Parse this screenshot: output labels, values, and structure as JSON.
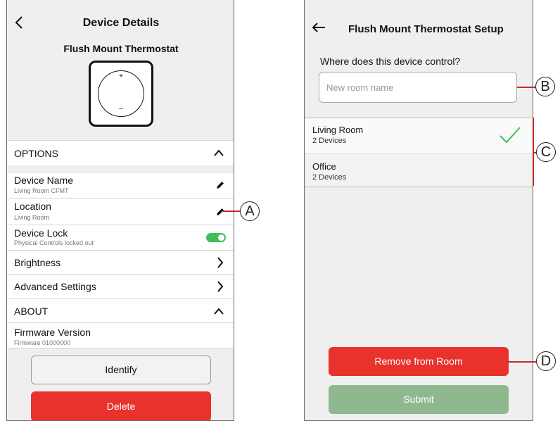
{
  "left": {
    "header_title": "Device Details",
    "device_name": "Flush Mount Thermostat",
    "thermostat_plus": "+",
    "thermostat_minus": "–",
    "options_header": "OPTIONS",
    "rows": [
      {
        "label": "Device Name",
        "sub": "Living Room CFMT"
      },
      {
        "label": "Location",
        "sub": "Living Room"
      },
      {
        "label": "Device Lock",
        "sub": "Physical Controls locked out",
        "toggle_on": true
      },
      {
        "label": "Brightness"
      },
      {
        "label": "Advanced Settings"
      }
    ],
    "about_header": "ABOUT",
    "firmware": {
      "label": "Firmware Version",
      "sub": "Firmware 01000000"
    },
    "identify_label": "Identify",
    "delete_label": "Delete"
  },
  "right": {
    "header_title": "Flush Mount Thermostat Setup",
    "question": "Where does this device control?",
    "room_input_placeholder": "New room name",
    "rooms": [
      {
        "name": "Living Room",
        "count": "2 Devices",
        "selected": true
      },
      {
        "name": "Office",
        "count": "2 Devices",
        "selected": false
      }
    ],
    "remove_label": "Remove from Room",
    "submit_label": "Submit"
  },
  "callouts": {
    "a": "A",
    "b": "B",
    "c": "C",
    "d": "D"
  },
  "colors": {
    "accent_red": "#e8322b",
    "toggle_green": "#3dbf5a",
    "submit_green": "#8fb88f",
    "check_green": "#3dbf5a",
    "callout_line": "#c62828"
  }
}
